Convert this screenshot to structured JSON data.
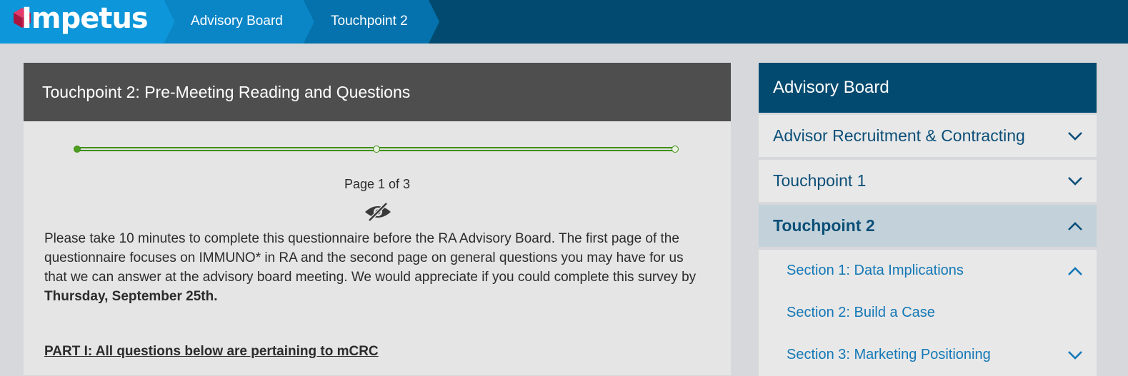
{
  "header": {
    "logo_text": "Impetus",
    "breadcrumbs": [
      "Advisory Board",
      "Touchpoint 2"
    ]
  },
  "card": {
    "title": "Touchpoint 2: Pre-Meeting Reading and Questions",
    "progress": {
      "current_page": 1,
      "total_pages": 3
    },
    "page_label": "Page 1 of 3",
    "intro_text": "Please take 10 minutes to complete this questionnaire before the RA Advisory Board.  The first page of the questionnaire focuses on IMMUNO* in RA and the second page on general questions you may have for us that we can answer at the advisory board meeting. We would appreciate if you could complete this survey by ",
    "intro_deadline": "Thursday, September 25th.",
    "part_heading": "PART I: All questions below are pertaining to mCRC"
  },
  "sidebar": {
    "title": "Advisory Board",
    "items": [
      {
        "label": "Advisor Recruitment & Contracting",
        "expanded": false
      },
      {
        "label": "Touchpoint 1",
        "expanded": false
      },
      {
        "label": "Touchpoint 2",
        "expanded": true,
        "active": true
      },
      {
        "label": "Section 1: Data Implications",
        "expanded": true
      },
      {
        "label": "Section 2: Build a Case"
      },
      {
        "label": "Section 3: Marketing Positioning",
        "expanded": false
      }
    ]
  },
  "colors": {
    "top_bar": "#024a6f",
    "accent_blue": "#0d96d9",
    "progress_green": "#3f8f17",
    "card_header": "#4e4e4e"
  },
  "icons": [
    "logo-cube-icon",
    "eye-slash-icon",
    "chevron-down-icon",
    "chevron-up-icon"
  ]
}
